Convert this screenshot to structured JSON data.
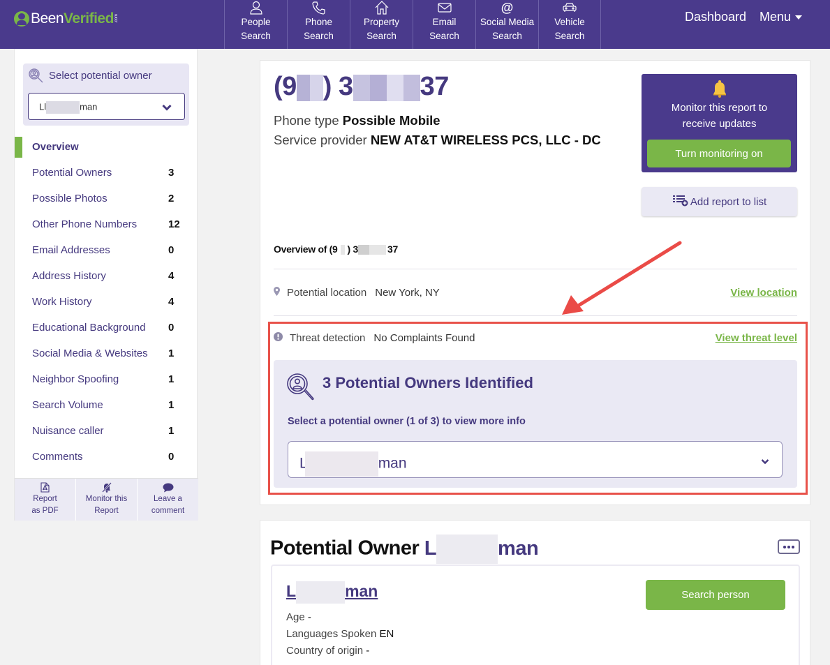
{
  "header": {
    "logo_part1": "Been",
    "logo_part2": "Verified",
    "logo_suffix": ".com",
    "nav": [
      {
        "line1": "People",
        "line2": "Search",
        "icon": "person-icon"
      },
      {
        "line1": "Phone",
        "line2": "Search",
        "icon": "phone-icon"
      },
      {
        "line1": "Property",
        "line2": "Search",
        "icon": "house-icon"
      },
      {
        "line1": "Email",
        "line2": "Search",
        "icon": "envelope-icon"
      },
      {
        "line1": "Social Media",
        "line2": "Search",
        "icon": "at-sign-icon"
      },
      {
        "line1": "Vehicle",
        "line2": "Search",
        "icon": "car-icon"
      }
    ],
    "dashboard": "Dashboard",
    "menu": "Menu"
  },
  "sidebar": {
    "select_title": "Select potential owner",
    "selected_owner": {
      "prefix": "Ll",
      "suffix": "man"
    },
    "items": [
      {
        "label": "Overview",
        "count": ""
      },
      {
        "label": "Potential Owners",
        "count": "3"
      },
      {
        "label": "Possible Photos",
        "count": "2"
      },
      {
        "label": "Other Phone Numbers",
        "count": "12"
      },
      {
        "label": "Email Addresses",
        "count": "0"
      },
      {
        "label": "Address History",
        "count": "4"
      },
      {
        "label": "Work History",
        "count": "4"
      },
      {
        "label": "Educational Background",
        "count": "0"
      },
      {
        "label": "Social Media & Websites",
        "count": "1"
      },
      {
        "label": "Neighbor Spoofing",
        "count": "1"
      },
      {
        "label": "Search Volume",
        "count": "1"
      },
      {
        "label": "Nuisance caller",
        "count": "1"
      },
      {
        "label": "Comments",
        "count": "0"
      }
    ],
    "actions": [
      {
        "line1": "Report",
        "line2": "as PDF",
        "icon": "pdf-icon"
      },
      {
        "line1": "Monitor this",
        "line2": "Report",
        "icon": "bell-off-icon"
      },
      {
        "line1": "Leave a",
        "line2": "comment",
        "icon": "comment-icon"
      }
    ]
  },
  "report": {
    "phone_prefix": "(9",
    "phone_mid": ") 3",
    "phone_suffix": "37",
    "phone_type_label": "Phone type",
    "phone_type_value": "Possible Mobile",
    "provider_label": "Service provider",
    "provider_value": "NEW AT&T WIRELESS PCS, LLC - DC",
    "monitor_msg_line1": "Monitor this report to",
    "monitor_msg_line2": "receive updates",
    "monitor_button": "Turn monitoring on",
    "add_list_button": "Add report to list",
    "overview_prefix": "Overview of (9",
    "overview_mid": ") 3",
    "overview_suffix": "37",
    "location_label": "Potential location",
    "location_value": "New York, NY",
    "location_link": "View location",
    "threat_label": "Threat detection",
    "threat_value": "No Complaints Found",
    "threat_link": "View threat level",
    "owners_title": "3 Potential Owners Identified",
    "owners_subtitle": "Select a potential owner (1 of 3) to view more info",
    "owners_selected": {
      "prefix": "L",
      "suffix": "man"
    }
  },
  "owner_section": {
    "heading": "Potential Owner",
    "name_prefix": "L",
    "name_suffix": "man",
    "search_button": "Search person",
    "age_label": "Age",
    "age_value": "-",
    "languages_label": "Languages Spoken",
    "languages_value": "EN",
    "country_label": "Country of origin",
    "country_value": "-"
  },
  "colors": {
    "brand_purple": "#4a3a8c",
    "brand_green": "#7ab648",
    "annotation_red": "#e8524a"
  }
}
